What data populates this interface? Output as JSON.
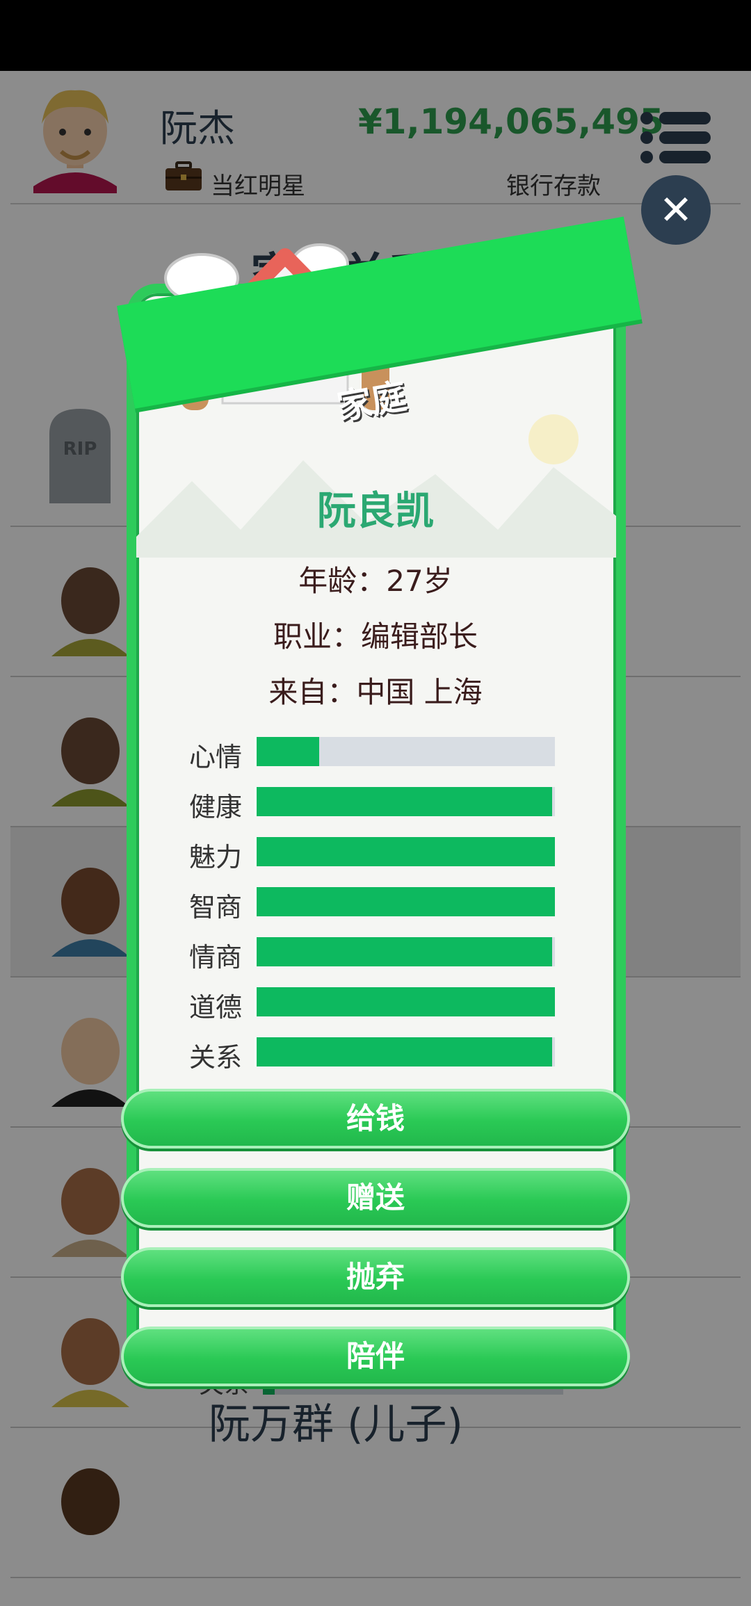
{
  "header": {
    "player_name": "阮杰",
    "money": "¥1,194,065,495",
    "job": "当红明星",
    "bank_label": "银行存款"
  },
  "section": {
    "title": "家庭关系"
  },
  "background_list": {
    "partial_name": "阮万群 (儿子)",
    "partial_stat_label": "关系",
    "partial_stat_value": 0.04
  },
  "modal": {
    "banner": "家庭",
    "name": "阮良凯",
    "age_line": "年龄：27岁",
    "job_line": "职业：编辑部长",
    "from_line": "来自：中国 上海",
    "stats": [
      {
        "label": "心情",
        "value": 0.21
      },
      {
        "label": "健康",
        "value": 0.99
      },
      {
        "label": "魅力",
        "value": 1.0
      },
      {
        "label": "智商",
        "value": 1.0
      },
      {
        "label": "情商",
        "value": 0.99
      },
      {
        "label": "道德",
        "value": 1.0
      },
      {
        "label": "关系",
        "value": 0.99
      }
    ],
    "actions": [
      "给钱",
      "赠送",
      "抛弃",
      "陪伴"
    ]
  },
  "colors": {
    "accent_green": "#2ecb5b",
    "bar_fill": "#0db95f",
    "money_green": "#2e9e4f",
    "dark_navy": "#2c3e50"
  },
  "icons": {
    "menu": "list-menu-icon",
    "close": "close-x-icon",
    "job": "briefcase-icon",
    "banner": "house-icon"
  }
}
